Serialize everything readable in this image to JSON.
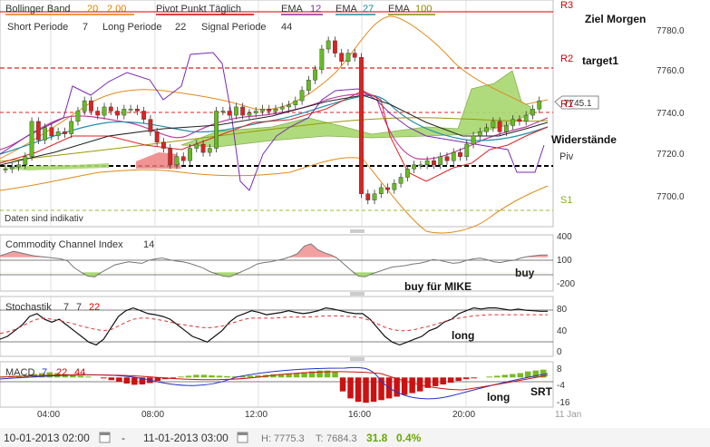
{
  "header": {
    "bollinger": {
      "name": "Bollinger Band",
      "p1": "20",
      "p2": "2.00",
      "color": "#e07b00"
    },
    "pivot": {
      "name": "Pivot Punkt Täglich",
      "color": "#cc0000"
    },
    "ema1": {
      "name": "EMA",
      "p": "12",
      "color": "#8a2a9a"
    },
    "ema2": {
      "name": "EMA",
      "p": "27",
      "color": "#1a8aa0"
    },
    "ema3": {
      "name": "EMA",
      "p": "100",
      "color": "#888800"
    },
    "ichimoku": {
      "short": "Short Periode",
      "short_v": "7",
      "long": "Long Periode",
      "long_v": "22",
      "signal": "Signal Periode",
      "signal_v": "44"
    }
  },
  "annotations": {
    "ziel": "Ziel Morgen",
    "target": "target1",
    "wider": "Widerstände",
    "buy_mike": "buy für MIKE",
    "buy": "buy",
    "long1": "long",
    "long2": "long",
    "srt": "SRT",
    "disclaimer": "Daten sind indikativ"
  },
  "pivots": {
    "r3": "R3",
    "r2": "R2",
    "r1": "R1",
    "piv": "Piv",
    "s1": "S1"
  },
  "price_tag": "7745.1",
  "panels": {
    "cci": {
      "name": "Commodity Channel Index",
      "p": "14"
    },
    "stoch": {
      "name": "Stochastik",
      "p1": "7",
      "p2": "7",
      "p3": "22"
    },
    "macd": {
      "name": "MACD",
      "p1": "7",
      "p2": "22",
      "p3": "44"
    }
  },
  "footer": {
    "from": "10-01-2013 02:00",
    "to": "11-01-2013 03:00",
    "h_label": "H:",
    "h": "7775.3",
    "t_label": "T:",
    "t": "7684.3",
    "change": "31.8",
    "change_pct": "0.4%"
  },
  "chart_data": [
    {
      "type": "candlestick",
      "title": "",
      "x_ticks": [
        "04:00",
        "08:00",
        "12:00",
        "16:00",
        "20:00",
        "11 Jan"
      ],
      "y_ticks": [
        "7780.0",
        "7760.0",
        "7740.0",
        "7720.0",
        "7700.0"
      ],
      "ylim": [
        7692,
        7788
      ],
      "pivot_levels": {
        "R3": 7788,
        "R2": 7763.5,
        "R1": 7741.5,
        "Piv": 7713.5,
        "S1": 7694
      },
      "close": [
        7712,
        7713,
        7714,
        7718,
        7735,
        7726,
        7732,
        7728,
        7730,
        7729,
        7735,
        7740,
        7745,
        7740,
        7738,
        7742,
        7740,
        7738,
        7741,
        7741,
        7740,
        7736,
        7730,
        7725,
        7722,
        7714,
        7718,
        7716,
        7722,
        7724,
        7720,
        7722,
        7740,
        7740,
        7738,
        7742,
        7738,
        7739,
        7740,
        7741,
        7740,
        7741,
        7742,
        7743,
        7745,
        7750,
        7755,
        7760,
        7770,
        7774,
        7768,
        7764,
        7768,
        7766,
        7700,
        7697,
        7700,
        7703,
        7702,
        7705,
        7708,
        7712,
        7714,
        7714,
        7716,
        7714,
        7718,
        7716,
        7720,
        7718,
        7724,
        7728,
        7730,
        7732,
        7735,
        7730,
        7733,
        7736,
        7735,
        7738,
        7741,
        7745
      ],
      "cloud": {
        "green": [
          [
            31,
            7732
          ],
          [
            34,
            7736
          ],
          [
            40,
            7740
          ],
          [
            47,
            7745
          ],
          [
            51,
            7750
          ],
          [
            56,
            7738
          ],
          [
            60,
            7740
          ],
          [
            65,
            7745
          ],
          [
            70,
            7736
          ],
          [
            72,
            7755
          ],
          [
            75,
            7758
          ],
          [
            77,
            7762
          ],
          [
            78,
            7760
          ],
          [
            79,
            7748
          ],
          [
            81,
            7745
          ]
        ],
        "red_box": [
          4,
          10
        ]
      }
    },
    {
      "type": "line",
      "name": "Commodity Channel Index",
      "y_ticks": [
        "400",
        "100",
        "-200"
      ],
      "ylim": [
        -350,
        400
      ],
      "values": [
        120,
        150,
        180,
        160,
        140,
        120,
        110,
        100,
        90,
        80,
        50,
        -40,
        -100,
        -150,
        -160,
        -100,
        -50,
        0,
        20,
        40,
        30,
        20,
        60,
        80,
        90,
        70,
        50,
        40,
        20,
        -10,
        -40,
        -90,
        -120,
        -150,
        -160,
        -120,
        -80,
        -40,
        10,
        30,
        40,
        60,
        80,
        110,
        150,
        250,
        280,
        200,
        160,
        130,
        80,
        0,
        -80,
        -150,
        -160,
        -120,
        -90,
        -60,
        -30,
        -20,
        -10,
        10,
        20,
        40,
        70,
        60,
        40,
        20,
        30,
        60,
        80,
        90,
        70,
        40,
        30,
        50,
        60,
        90,
        110,
        120,
        130,
        130
      ]
    },
    {
      "type": "line",
      "name": "Stochastik",
      "y_ticks": [
        "80",
        "40",
        "0"
      ],
      "ylim": [
        -5,
        100
      ],
      "series": [
        {
          "values": [
            25,
            30,
            40,
            50,
            65,
            70,
            60,
            55,
            60,
            50,
            40,
            30,
            20,
            15,
            25,
            45,
            65,
            75,
            80,
            75,
            70,
            68,
            65,
            60,
            50,
            40,
            30,
            25,
            20,
            30,
            40,
            55,
            65,
            70,
            75,
            72,
            68,
            70,
            72,
            75,
            72,
            70,
            72,
            75,
            80,
            78,
            75,
            72,
            70,
            70,
            60,
            45,
            30,
            20,
            15,
            20,
            25,
            30,
            40,
            45,
            55,
            60,
            70,
            75,
            80,
            78,
            80,
            80,
            78,
            76,
            78,
            76,
            75,
            74,
            74
          ]
        },
        {
          "values": [
            35,
            38,
            42,
            48,
            55,
            60,
            62,
            60,
            58,
            55,
            52,
            48,
            45,
            42,
            40,
            42,
            48,
            55,
            60,
            62,
            62,
            60,
            58,
            55,
            52,
            50,
            48,
            46,
            45,
            46,
            48,
            52,
            56,
            60,
            62,
            62,
            62,
            62,
            63,
            64,
            64,
            64,
            64,
            65,
            66,
            66,
            66,
            65,
            64,
            62,
            58,
            52,
            46,
            42,
            40,
            40,
            42,
            45,
            48,
            52,
            56,
            60,
            62,
            64,
            66,
            67,
            68,
            68,
            68,
            68,
            68,
            68,
            68,
            68,
            68
          ]
        }
      ]
    },
    {
      "type": "bar",
      "name": "MACD",
      "y_ticks": [
        "8",
        "-4",
        "-16"
      ],
      "ylim": [
        -17,
        9
      ],
      "values": [
        0.5,
        0.8,
        1.0,
        1.2,
        2.0,
        2.5,
        3.0,
        2.5,
        2.0,
        1.5,
        1.0,
        0.5,
        0.0,
        -0.5,
        -1.5,
        -2.5,
        -3.5,
        -4.2,
        -4.0,
        -3.2,
        -2.0,
        -1.0,
        -0.5,
        0.5,
        1.0,
        1.5,
        1.5,
        1.2,
        1.0,
        0.8,
        0.6,
        0.8,
        1.0,
        1.2,
        1.5,
        1.8,
        2.0,
        2.2,
        2.5,
        3.0,
        3.5,
        4.0,
        4.0,
        3.5,
        -8,
        -12,
        -14,
        -14.5,
        -14,
        -13,
        -12,
        -11,
        -10,
        -9,
        -8,
        -6,
        -5,
        -4,
        -3,
        -2,
        -1,
        -0.5,
        0,
        0.5,
        1.0,
        1.5,
        2.0,
        2.5,
        3.5,
        4.0,
        4.5
      ]
    }
  ]
}
